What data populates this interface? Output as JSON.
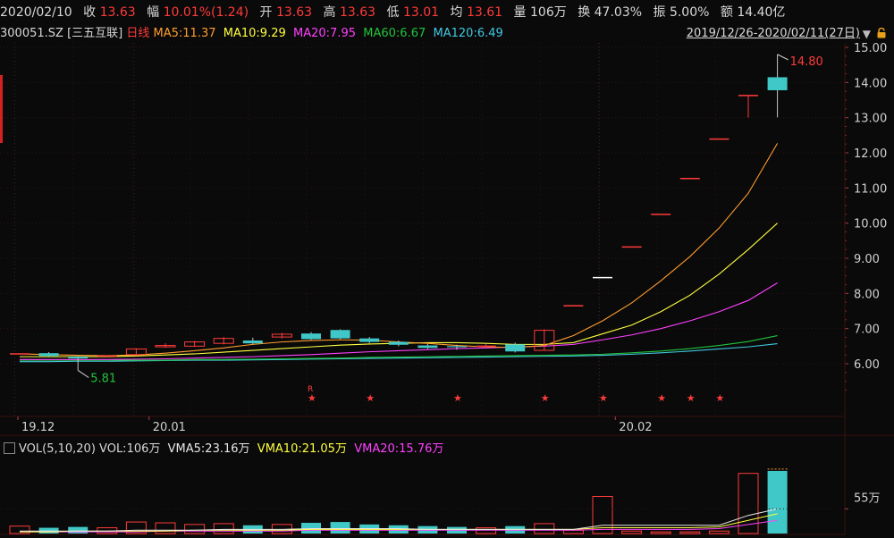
{
  "info": {
    "date": "2020/02/10",
    "close_label": "收",
    "close": "13.63",
    "change_label": "幅",
    "change": "10.01%(1.24)",
    "open_label": "开",
    "open": "13.63",
    "high_label": "高",
    "high": "13.63",
    "low_label": "低",
    "low": "13.01",
    "avg_label": "均",
    "avg": "13.61",
    "vol_label": "量",
    "vol": "106万",
    "turnover_label": "换",
    "turnover": "47.03%",
    "amplitude_label": "振",
    "amplitude": "5.00%",
    "amount_label": "额",
    "amount": "14.40亿"
  },
  "ma_bar": {
    "code": "300051.SZ",
    "name": "[三五互联]",
    "period": "日线",
    "ma5": "MA5:11.37",
    "ma10": "MA10:9.29",
    "ma20": "MA20:7.95",
    "ma60": "MA60:6.67",
    "ma120": "MA120:6.49",
    "range": "2019/12/26-2020/02/11(27日)"
  },
  "vol_bar": {
    "title": "VOL(5,10,20)",
    "vol": "VOL:106万",
    "vma5": "VMA5:23.16万",
    "vma10": "VMA10:21.05万",
    "vma20": "VMA20:15.76万"
  },
  "colors": {
    "up": "#ff3b3b",
    "down": "#40c8c8",
    "ma5": "#ff9d2e",
    "ma10": "#ffff40",
    "ma20": "#ff40ff",
    "ma60": "#22c33a",
    "ma120": "#40c8e0",
    "grid": "#3a1010"
  },
  "chart_data": {
    "type": "candlestick",
    "price_axis": {
      "ylim": [
        5.0,
        15.3
      ],
      "ticks": [
        "6.00",
        "7.00",
        "8.00",
        "9.00",
        "10.00",
        "11.00",
        "12.00",
        "13.00",
        "14.00",
        "15.00"
      ]
    },
    "x_tick_labels": [
      {
        "label": "19.12",
        "index": 0
      },
      {
        "label": "20.01",
        "index": 4.5
      },
      {
        "label": "20.02",
        "index": 20.5
      }
    ],
    "annotations": {
      "high": "14.80",
      "low": "5.81",
      "star": "★",
      "r_mark": "R"
    },
    "candles": [
      {
        "o": 6.28,
        "c": 6.28,
        "h": 6.29,
        "l": 6.27,
        "v": 9
      },
      {
        "o": 6.3,
        "c": 6.22,
        "h": 6.33,
        "l": 6.2,
        "v": 7
      },
      {
        "o": 6.2,
        "c": 6.15,
        "h": 6.22,
        "l": 5.81,
        "v": 8
      },
      {
        "o": 6.2,
        "c": 6.22,
        "h": 6.24,
        "l": 6.18,
        "v": 7
      },
      {
        "o": 6.26,
        "c": 6.42,
        "h": 6.44,
        "l": 6.24,
        "v": 14
      },
      {
        "o": 6.48,
        "c": 6.52,
        "h": 6.58,
        "l": 6.45,
        "v": 13
      },
      {
        "o": 6.5,
        "c": 6.62,
        "h": 6.65,
        "l": 6.48,
        "v": 11
      },
      {
        "o": 6.58,
        "c": 6.72,
        "h": 6.76,
        "l": 6.55,
        "v": 12
      },
      {
        "o": 6.66,
        "c": 6.58,
        "h": 6.74,
        "l": 6.55,
        "v": 10
      },
      {
        "o": 6.76,
        "c": 6.84,
        "h": 6.88,
        "l": 6.72,
        "v": 11
      },
      {
        "o": 6.86,
        "c": 6.7,
        "h": 6.9,
        "l": 6.68,
        "v": 13
      },
      {
        "o": 6.96,
        "c": 6.72,
        "h": 6.98,
        "l": 6.7,
        "v": 14
      },
      {
        "o": 6.72,
        "c": 6.62,
        "h": 6.76,
        "l": 6.58,
        "v": 11
      },
      {
        "o": 6.62,
        "c": 6.54,
        "h": 6.66,
        "l": 6.5,
        "v": 10
      },
      {
        "o": 6.52,
        "c": 6.45,
        "h": 6.56,
        "l": 6.42,
        "v": 9
      },
      {
        "o": 6.5,
        "c": 6.48,
        "h": 6.54,
        "l": 6.4,
        "v": 8
      },
      {
        "o": 6.5,
        "c": 6.5,
        "h": 6.56,
        "l": 6.46,
        "v": 7
      },
      {
        "o": 6.55,
        "c": 6.35,
        "h": 6.6,
        "l": 6.32,
        "v": 9
      },
      {
        "o": 6.38,
        "c": 6.95,
        "h": 6.98,
        "l": 6.38,
        "v": 12
      },
      {
        "o": 7.65,
        "c": 7.65,
        "h": 7.65,
        "l": 7.65,
        "v": 4
      },
      {
        "o": 8.45,
        "c": 8.45,
        "h": 8.45,
        "l": 8.45,
        "v": 45
      },
      {
        "o": 9.32,
        "c": 9.32,
        "h": 9.32,
        "l": 9.32,
        "v": 3
      },
      {
        "o": 10.25,
        "c": 10.25,
        "h": 10.25,
        "l": 10.25,
        "v": 2
      },
      {
        "o": 11.27,
        "c": 11.27,
        "h": 11.27,
        "l": 11.27,
        "v": 2
      },
      {
        "o": 12.39,
        "c": 12.39,
        "h": 12.39,
        "l": 12.39,
        "v": 3
      },
      {
        "o": 13.63,
        "c": 13.63,
        "h": 13.63,
        "l": 13.0,
        "v": 73
      },
      {
        "o": 14.15,
        "c": 13.78,
        "h": 14.8,
        "l": 13.01,
        "v": 76
      }
    ],
    "star_indices": [
      10,
      12,
      15,
      18,
      20,
      22,
      23,
      24
    ],
    "ma": {
      "ma5": [
        6.28,
        6.26,
        6.24,
        6.23,
        6.25,
        6.3,
        6.37,
        6.45,
        6.55,
        6.62,
        6.66,
        6.68,
        6.67,
        6.62,
        6.58,
        6.52,
        6.48,
        6.46,
        6.52,
        6.8,
        7.22,
        7.73,
        8.36,
        9.05,
        9.86,
        10.85,
        12.27
      ],
      "ma10": [
        6.2,
        6.2,
        6.2,
        6.2,
        6.22,
        6.25,
        6.28,
        6.33,
        6.38,
        6.43,
        6.48,
        6.53,
        6.56,
        6.58,
        6.6,
        6.6,
        6.58,
        6.55,
        6.55,
        6.6,
        6.85,
        7.1,
        7.48,
        7.95,
        8.55,
        9.25,
        10.0
      ],
      "ma20": [
        6.12,
        6.12,
        6.12,
        6.12,
        6.13,
        6.14,
        6.16,
        6.18,
        6.2,
        6.23,
        6.26,
        6.3,
        6.34,
        6.37,
        6.4,
        6.43,
        6.45,
        6.48,
        6.5,
        6.55,
        6.68,
        6.82,
        7.0,
        7.22,
        7.48,
        7.8,
        8.3
      ],
      "ma60": [
        6.1,
        6.1,
        6.1,
        6.1,
        6.1,
        6.1,
        6.12,
        6.12,
        6.13,
        6.14,
        6.15,
        6.16,
        6.18,
        6.19,
        6.2,
        6.21,
        6.22,
        6.23,
        6.24,
        6.25,
        6.27,
        6.31,
        6.36,
        6.43,
        6.52,
        6.63,
        6.8
      ],
      "ma120": [
        6.06,
        6.06,
        6.07,
        6.07,
        6.08,
        6.09,
        6.1,
        6.1,
        6.11,
        6.12,
        6.13,
        6.14,
        6.15,
        6.16,
        6.17,
        6.18,
        6.19,
        6.2,
        6.21,
        6.22,
        6.24,
        6.27,
        6.31,
        6.36,
        6.42,
        6.48,
        6.57
      ]
    },
    "volume": {
      "unit": "万",
      "ylim": [
        0,
        90
      ],
      "ticks": [
        {
          "value": 30,
          "label": "55万"
        }
      ],
      "vma5": [
        3,
        3,
        3,
        3,
        4,
        4,
        4,
        5,
        5,
        5,
        6,
        6,
        6,
        6,
        5,
        5,
        5,
        5,
        5,
        5,
        10,
        10,
        10,
        10,
        10,
        22,
        30
      ],
      "vma10": [
        2,
        2,
        3,
        3,
        3,
        3,
        4,
        4,
        4,
        4,
        5,
        5,
        5,
        5,
        5,
        5,
        5,
        5,
        5,
        5,
        7,
        7,
        7,
        7,
        8,
        16,
        24
      ],
      "vma20": [
        2,
        2,
        2,
        2,
        2,
        3,
        3,
        3,
        3,
        3,
        4,
        4,
        4,
        4,
        4,
        4,
        4,
        4,
        4,
        4,
        5,
        5,
        5,
        5,
        6,
        11,
        16
      ]
    }
  }
}
